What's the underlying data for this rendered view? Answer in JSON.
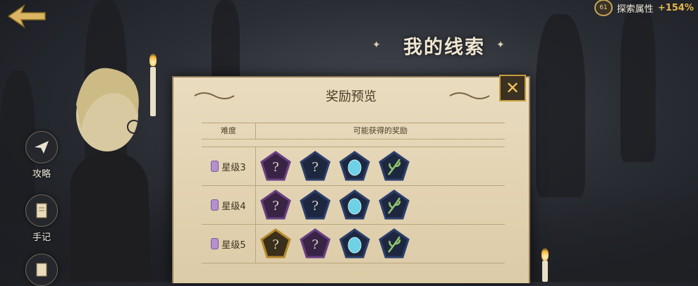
{
  "header": {
    "explore_badge": "61",
    "explore_label": "探索属性",
    "explore_value": "+154%"
  },
  "clues_title": "我的线索",
  "sidebar": [
    {
      "label": "攻略",
      "icon": "paper-plane-icon"
    },
    {
      "label": "手记",
      "icon": "scroll-icon"
    },
    {
      "label": "",
      "icon": "map-scroll-icon"
    }
  ],
  "reward_panel": {
    "title": "奖励预览",
    "close_icon": "close-icon",
    "columns": [
      "难度",
      "可能获得的奖励"
    ],
    "rows": [
      {
        "difficulty": "星级3",
        "rewards": [
          "purple-mystery",
          "blue-mystery",
          "blue-crystal",
          "herb"
        ]
      },
      {
        "difficulty": "星级4",
        "rewards": [
          "purple-mystery",
          "blue-mystery",
          "blue-crystal",
          "herb"
        ]
      },
      {
        "difficulty": "星级5",
        "rewards": [
          "gold-mystery",
          "purple-mystery",
          "blue-crystal",
          "herb"
        ]
      }
    ]
  },
  "colors": {
    "accent_gold": "#c79c3c",
    "parchment": "#e9dcbf",
    "purple_frame": "#6a3f82",
    "blue_frame": "#2c3f6b",
    "gold_frame": "#b48a2c"
  }
}
